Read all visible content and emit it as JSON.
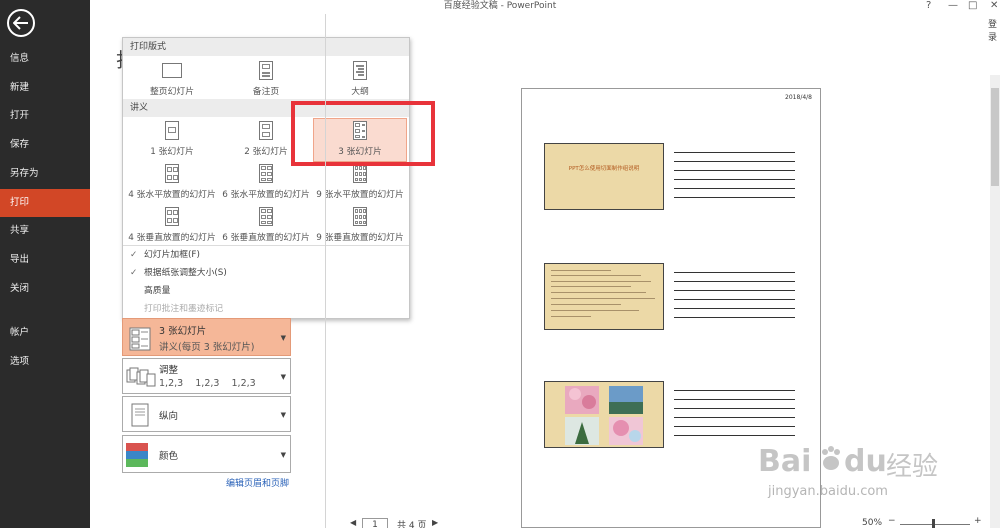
{
  "window": {
    "title": "百度经验文稿 - PowerPoint",
    "help": "?",
    "minimize": "—",
    "restore": "□",
    "close": "✕",
    "login": "登录"
  },
  "sidebar": {
    "items": [
      {
        "label": "信息"
      },
      {
        "label": "新建"
      },
      {
        "label": "打开"
      },
      {
        "label": "保存"
      },
      {
        "label": "另存为"
      },
      {
        "label": "打印"
      },
      {
        "label": "共享"
      },
      {
        "label": "导出"
      },
      {
        "label": "关闭"
      },
      {
        "label": "帐户"
      },
      {
        "label": "选项"
      }
    ]
  },
  "panel": {
    "hidden_char": "打"
  },
  "popup": {
    "section_layout": "打印版式",
    "layout_options": [
      {
        "label": "整页幻灯片",
        "icon": "full-page-slide-icon"
      },
      {
        "label": "备注页",
        "icon": "notes-page-icon"
      },
      {
        "label": "大纲",
        "icon": "outline-icon"
      }
    ],
    "section_handouts": "讲义",
    "handout_options": [
      {
        "label": "1 张幻灯片"
      },
      {
        "label": "2 张幻灯片"
      },
      {
        "label": "3 张幻灯片"
      },
      {
        "label": "4 张水平放置的幻灯片"
      },
      {
        "label": "6 张水平放置的幻灯片"
      },
      {
        "label": "9 张水平放置的幻灯片"
      },
      {
        "label": "4 张垂直放置的幻灯片"
      },
      {
        "label": "6 张垂直放置的幻灯片"
      },
      {
        "label": "9 张垂直放置的幻灯片"
      }
    ],
    "checks": [
      {
        "label": "幻灯片加框(F)",
        "checked": "✓"
      },
      {
        "label": "根据纸张调整大小(S)",
        "checked": "✓"
      },
      {
        "label": "高质量",
        "checked": ""
      },
      {
        "label": "打印批注和墨迹标记",
        "checked": ""
      }
    ]
  },
  "settings": {
    "layout": {
      "title": "3 张幻灯片",
      "sub": "讲义(每页 3 张幻灯片)"
    },
    "collate": {
      "title": "调整",
      "sub": "1,2,3    1,2,3    1,2,3"
    },
    "orientation": {
      "title": "纵向"
    },
    "color": {
      "title": "颜色"
    },
    "edit_link": "编辑页眉和页脚",
    "dropdown_arrow": "▼"
  },
  "preview": {
    "date": "2018/4/8",
    "slide1_title": "PPT怎么使用切面制作组说明",
    "page_current": "1",
    "page_total": "共 4 页",
    "zoom": "50%",
    "nav_prev": "◀",
    "nav_next": "▶",
    "zoom_minus": "−",
    "zoom_plus": "+"
  },
  "watermark": {
    "brand": "Bai",
    "brand2": "du",
    "brand_cn": "经验",
    "url": "jingyan.baidu.com"
  },
  "colors": {
    "accent": "#d24726",
    "sidebar_bg": "#2b2b2b",
    "highlight": "#e8333a",
    "selected_setting": "#f5b798"
  }
}
